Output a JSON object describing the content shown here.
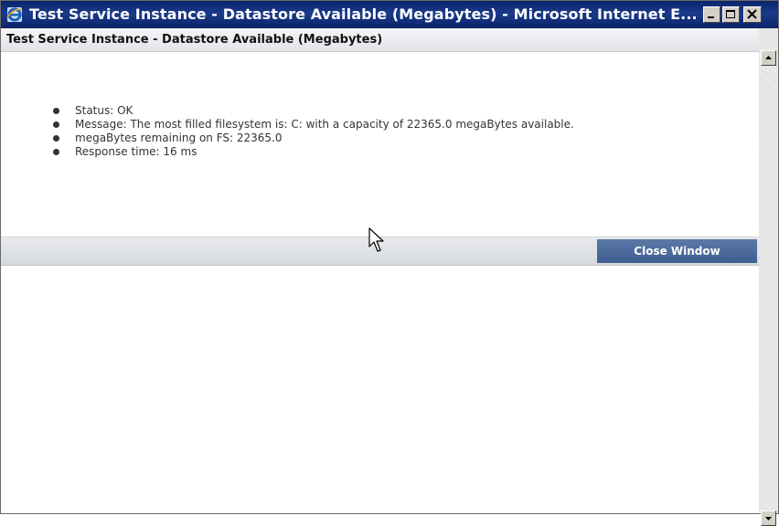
{
  "window": {
    "title": "Test Service Instance - Datastore Available (Megabytes) - Microsoft Internet E...",
    "icon": "internet-explorer-icon"
  },
  "caption_buttons": {
    "minimize_icon": "minimize-icon",
    "maximize_icon": "maximize-icon",
    "close_icon": "close-icon"
  },
  "panel": {
    "title": "Test Service Instance - Datastore Available (Megabytes)"
  },
  "details": [
    {
      "text": "Status: OK"
    },
    {
      "text": "Message: The most filled filesystem is: C: with a capacity of 22365.0 megaBytes available."
    },
    {
      "text": "megaBytes remaining on FS: 22365.0"
    },
    {
      "text": "Response time: 16 ms"
    }
  ],
  "footer": {
    "close_label": "Close Window"
  },
  "colors": {
    "titlebar": "#0a246a",
    "button": "#4a6a9c",
    "header_gray": "#e2e4e8"
  }
}
